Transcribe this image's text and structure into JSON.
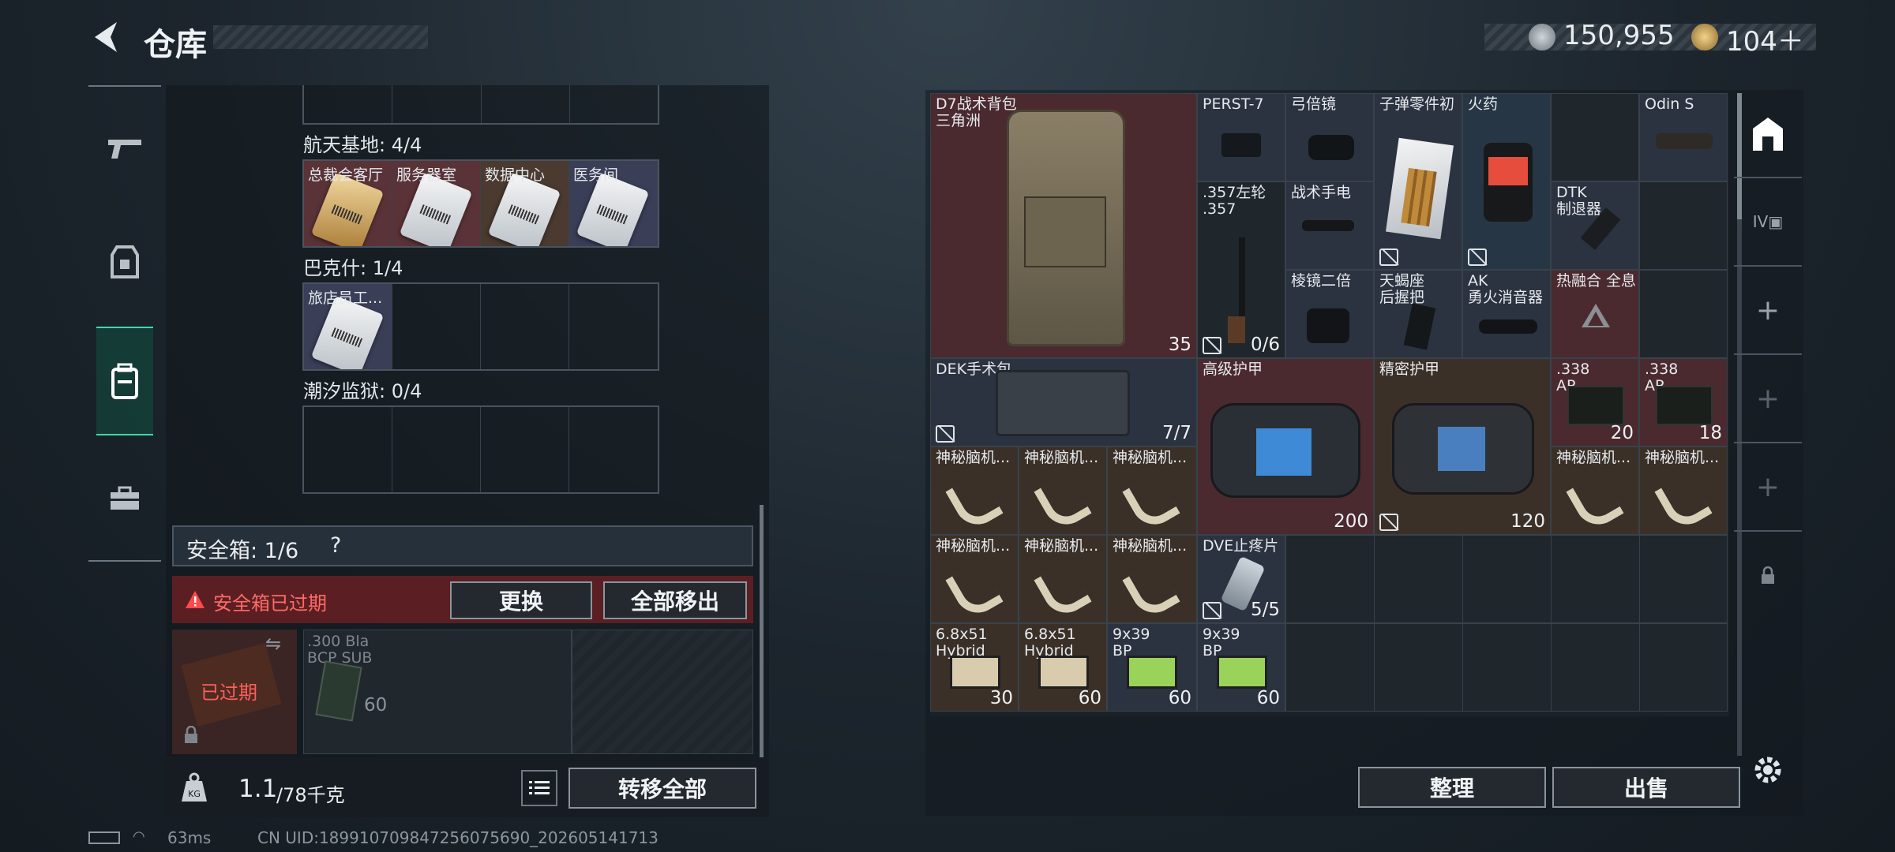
{
  "header": {
    "title": "仓库",
    "currency1": "150,955",
    "currency2": "104＋"
  },
  "left": {
    "sections": [
      {
        "label": "航天基地: 4/4",
        "items": [
          "总裁会客厅",
          "服务器室",
          "数据中心",
          "医务间"
        ]
      },
      {
        "label": "巴克什: 1/4",
        "items": [
          "旅店员工..."
        ]
      },
      {
        "label": "潮汐监狱: 0/4",
        "items": []
      }
    ],
    "safe": {
      "label": "安全箱: 1/6",
      "help": "?",
      "expired_msg": "安全箱已过期",
      "replace": "更换",
      "remove_all": "全部移出",
      "expired_tag": "已过期",
      "ammo_label": ".300 Bla\nBCP SUB",
      "ammo_count": "60"
    },
    "weight": {
      "value": "1.1",
      "unit": "/78千克",
      "transfer": "转移全部"
    }
  },
  "right": {
    "items": [
      {
        "label": "D7战术背包\n三角洲",
        "count": "35"
      },
      {
        "label": "PERST-7",
        "count": ""
      },
      {
        "label": "弓倍镜",
        "count": ""
      },
      {
        "label": "子弹零件初",
        "count": ""
      },
      {
        "label": "火药",
        "count": ""
      },
      {
        "label": "Odin S",
        "count": ""
      },
      {
        "label": ".357左轮\n.357",
        "count": "0/6"
      },
      {
        "label": "战术手电",
        "count": ""
      },
      {
        "label": "DTK\n制退器",
        "count": ""
      },
      {
        "label": "棱镜二倍",
        "count": ""
      },
      {
        "label": "天蝎座\n后握把",
        "count": ""
      },
      {
        "label": "AK\n勇火消音器",
        "count": ""
      },
      {
        "label": "热融合 全息",
        "count": ""
      },
      {
        "label": "DEK手术包",
        "count": "7/7"
      },
      {
        "label": "高级护甲",
        "count": "200"
      },
      {
        "label": "精密护甲",
        "count": "120"
      },
      {
        "label": ".338\nAP",
        "count": "20"
      },
      {
        "label": ".338\nAP",
        "count": "18"
      },
      {
        "label": "神秘脑机...",
        "count": ""
      },
      {
        "label": "DVE止疼片",
        "count": "5/5"
      },
      {
        "label": "6.8x51\nHybrid",
        "count": "30"
      },
      {
        "label": "6.8x51\nHybrid",
        "count": "60"
      },
      {
        "label": "9x39\nBP",
        "count": "60"
      },
      {
        "label": "9x39\nBP",
        "count": "60"
      }
    ],
    "sort": "整理",
    "sell": "出售"
  },
  "status": {
    "ping": "63ms",
    "uid": "CN UID:189910709847256075690_202605141713"
  }
}
